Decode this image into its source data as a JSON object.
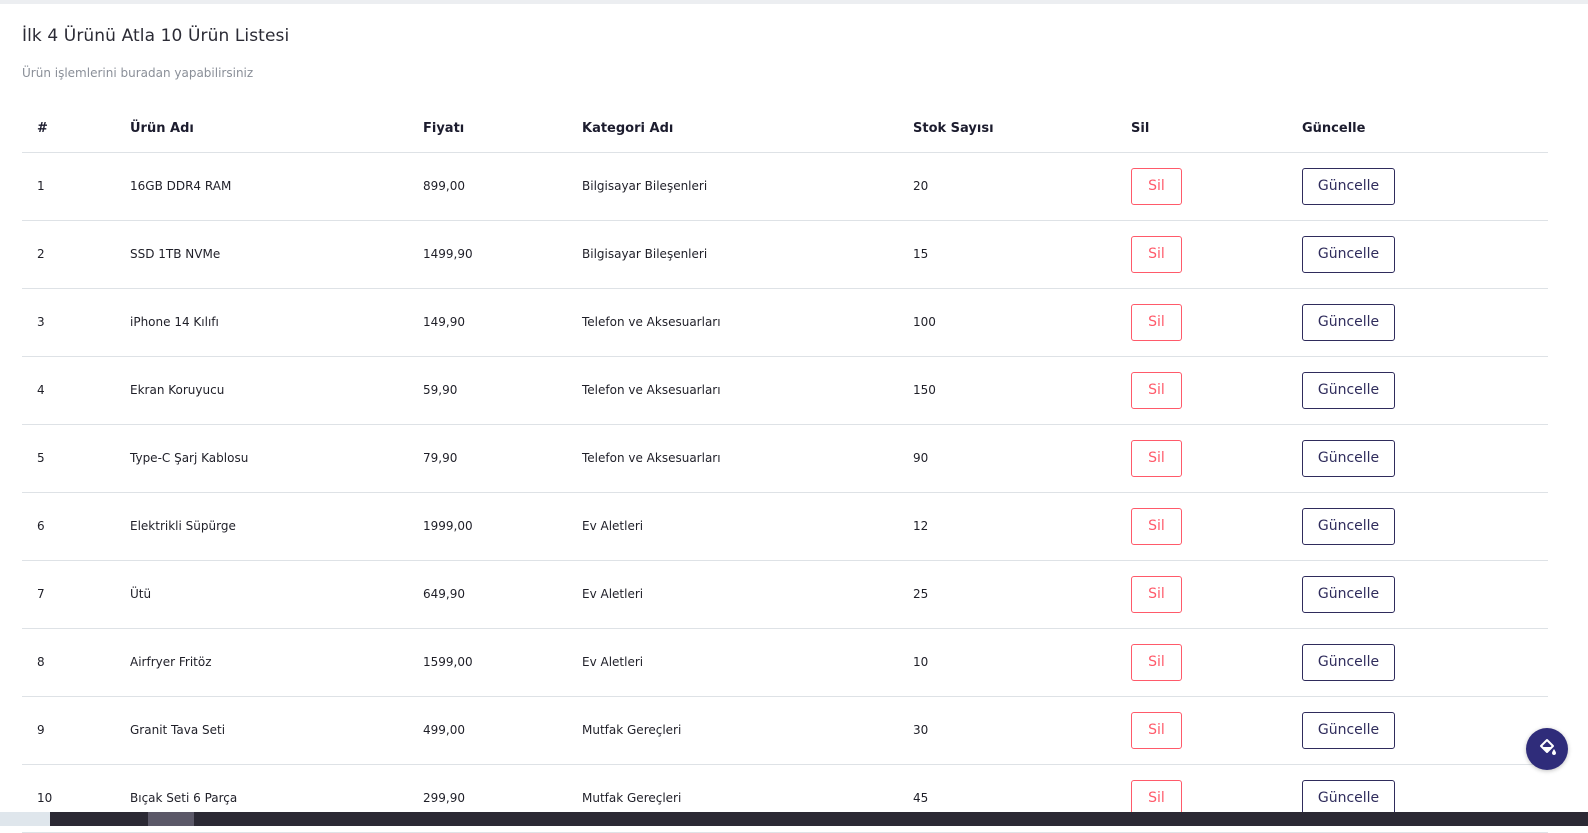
{
  "page": {
    "title": "İlk 4 Ürünü Atla 10 Ürün Listesi",
    "subtitle": "Ürün işlemlerini buradan yapabilirsiniz"
  },
  "table": {
    "headers": {
      "index": "#",
      "name": "Ürün Adı",
      "price": "Fiyatı",
      "category": "Kategori Adı",
      "stock": "Stok Sayısı",
      "delete": "Sil",
      "update": "Güncelle"
    },
    "rows": [
      {
        "index": "1",
        "name": "16GB DDR4 RAM",
        "price": "899,00",
        "category": "Bilgisayar Bileşenleri",
        "stock": "20",
        "delete_label": "Sil",
        "update_label": "Güncelle"
      },
      {
        "index": "2",
        "name": "SSD 1TB NVMe",
        "price": "1499,90",
        "category": "Bilgisayar Bileşenleri",
        "stock": "15",
        "delete_label": "Sil",
        "update_label": "Güncelle"
      },
      {
        "index": "3",
        "name": "iPhone 14 Kılıfı",
        "price": "149,90",
        "category": "Telefon ve Aksesuarları",
        "stock": "100",
        "delete_label": "Sil",
        "update_label": "Güncelle"
      },
      {
        "index": "4",
        "name": "Ekran Koruyucu",
        "price": "59,90",
        "category": "Telefon ve Aksesuarları",
        "stock": "150",
        "delete_label": "Sil",
        "update_label": "Güncelle"
      },
      {
        "index": "5",
        "name": "Type-C Şarj Kablosu",
        "price": "79,90",
        "category": "Telefon ve Aksesuarları",
        "stock": "90",
        "delete_label": "Sil",
        "update_label": "Güncelle"
      },
      {
        "index": "6",
        "name": "Elektrikli Süpürge",
        "price": "1999,00",
        "category": "Ev Aletleri",
        "stock": "12",
        "delete_label": "Sil",
        "update_label": "Güncelle"
      },
      {
        "index": "7",
        "name": "Ütü",
        "price": "649,90",
        "category": "Ev Aletleri",
        "stock": "25",
        "delete_label": "Sil",
        "update_label": "Güncelle"
      },
      {
        "index": "8",
        "name": "Airfryer Fritöz",
        "price": "1599,00",
        "category": "Ev Aletleri",
        "stock": "10",
        "delete_label": "Sil",
        "update_label": "Güncelle"
      },
      {
        "index": "9",
        "name": "Granit Tava Seti",
        "price": "499,00",
        "category": "Mutfak Gereçleri",
        "stock": "30",
        "delete_label": "Sil",
        "update_label": "Güncelle"
      },
      {
        "index": "10",
        "name": "Bıçak Seti 6 Parça",
        "price": "299,90",
        "category": "Mutfak Gereçleri",
        "stock": "45",
        "delete_label": "Sil",
        "update_label": "Güncelle"
      }
    ]
  },
  "fab": {
    "icon": "paint-bucket-icon"
  },
  "colors": {
    "delete_accent": "#ff5a6a",
    "update_accent": "#2f2c5c",
    "fab_background": "#2f2c7a"
  }
}
